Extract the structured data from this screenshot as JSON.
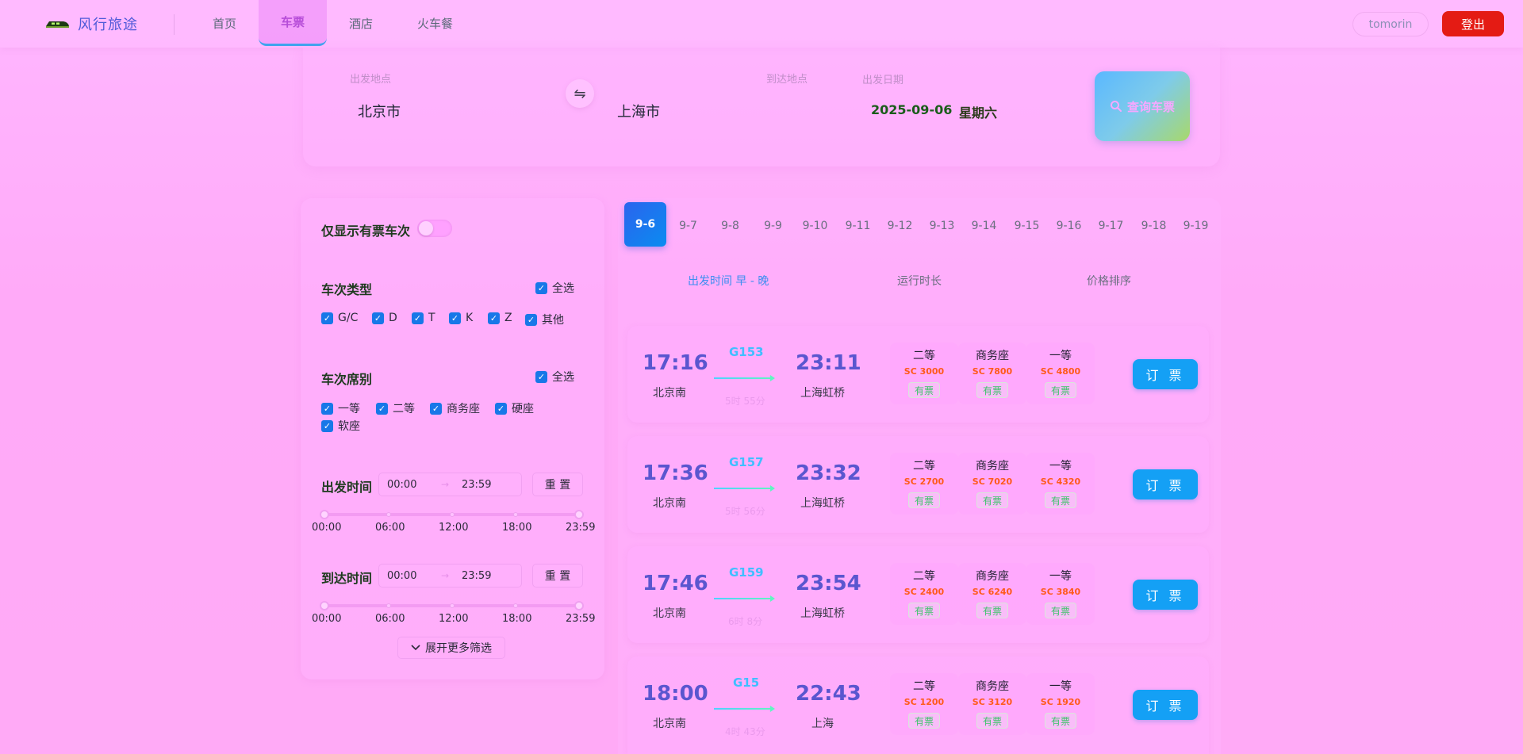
{
  "brand": {
    "name": "风行旅途"
  },
  "nav": {
    "items": [
      "首页",
      "车票",
      "酒店",
      "火车餐"
    ],
    "active_index": 1
  },
  "user": {
    "name": "tomorin",
    "logout_label": "登出"
  },
  "search": {
    "from_label": "出发地点",
    "from_value": "北京市",
    "swap_icon": "⇋",
    "to_label": "到达地点",
    "to_value": "上海市",
    "date_label": "出发日期",
    "date_value": "2025-09-06",
    "weekday": "星期六",
    "query_label": "查询车票"
  },
  "filters": {
    "available_only_label": "仅显示有票车次",
    "train_type": {
      "title": "车次类型",
      "select_all": "全选",
      "options": [
        "G/C",
        "D",
        "T",
        "K",
        "Z",
        "其他"
      ]
    },
    "seat_class": {
      "title": "车次席别",
      "select_all": "全选",
      "options": [
        "一等",
        "二等",
        "商务座",
        "硬座",
        "软座"
      ]
    },
    "departure_time": {
      "title": "出发时间",
      "from": "00:00",
      "arrow": "→",
      "to": "23:59",
      "reset": "重 置"
    },
    "arrival_time": {
      "title": "到达时间",
      "from": "00:00",
      "arrow": "→",
      "to": "23:59",
      "reset": "重 置"
    },
    "slider_labels": [
      "00:00",
      "06:00",
      "12:00",
      "18:00",
      "23:59"
    ],
    "expand_label": "展开更多筛选"
  },
  "dates": {
    "items": [
      "9-6",
      "9-7",
      "9-8",
      "9-9",
      "9-10",
      "9-11",
      "9-12",
      "9-13",
      "9-14",
      "9-15",
      "9-16",
      "9-17",
      "9-18",
      "9-19"
    ],
    "active_index": 0
  },
  "sort": {
    "items": [
      "出发时间  早 - 晚",
      "运行时长",
      "价格排序"
    ],
    "active_index": 0
  },
  "book_label": "订 票",
  "trains": [
    {
      "code": "G153",
      "depart": "17:16",
      "arrive": "23:11",
      "from": "北京南",
      "to": "上海虹桥",
      "duration": "5时 55分",
      "seats": [
        {
          "name": "二等",
          "price": "SC 3000",
          "stock": "有票"
        },
        {
          "name": "商务座",
          "price": "SC 7800",
          "stock": "有票"
        },
        {
          "name": "一等",
          "price": "SC 4800",
          "stock": "有票"
        }
      ]
    },
    {
      "code": "G157",
      "depart": "17:36",
      "arrive": "23:32",
      "from": "北京南",
      "to": "上海虹桥",
      "duration": "5时 56分",
      "seats": [
        {
          "name": "二等",
          "price": "SC 2700",
          "stock": "有票"
        },
        {
          "name": "商务座",
          "price": "SC 7020",
          "stock": "有票"
        },
        {
          "name": "一等",
          "price": "SC 4320",
          "stock": "有票"
        }
      ]
    },
    {
      "code": "G159",
      "depart": "17:46",
      "arrive": "23:54",
      "from": "北京南",
      "to": "上海虹桥",
      "duration": "6时 8分",
      "seats": [
        {
          "name": "二等",
          "price": "SC 2400",
          "stock": "有票"
        },
        {
          "name": "商务座",
          "price": "SC 6240",
          "stock": "有票"
        },
        {
          "name": "一等",
          "price": "SC 3840",
          "stock": "有票"
        }
      ]
    },
    {
      "code": "G15",
      "depart": "18:00",
      "arrive": "22:43",
      "from": "北京南",
      "to": "上海",
      "duration": "4时 43分",
      "seats": [
        {
          "name": "二等",
          "price": "SC 1200",
          "stock": "有票"
        },
        {
          "name": "商务座",
          "price": "SC 3120",
          "stock": "有票"
        },
        {
          "name": "一等",
          "price": "SC 1920",
          "stock": "有票"
        }
      ]
    }
  ],
  "colors": {
    "accent": "#14a0f5",
    "logout": "#e41b14",
    "price": "#ff5a1a",
    "stock": "#3ec46a",
    "time": "#5a56cf"
  }
}
